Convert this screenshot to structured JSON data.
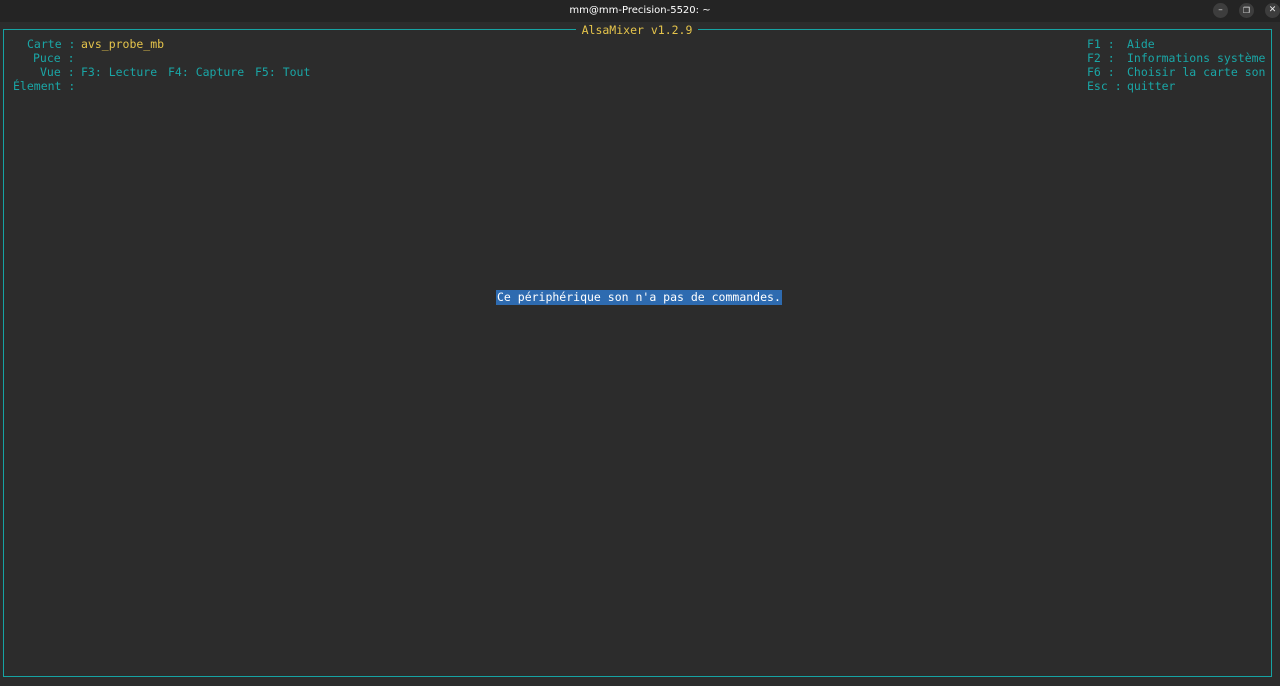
{
  "window": {
    "title": "mm@mm-Precision-5520: ~",
    "controls": {
      "minimize": "–",
      "maximize": "❐",
      "close": "✕"
    }
  },
  "mixer": {
    "title": "AlsaMixer v1.2.9",
    "card_label": "Carte :",
    "card_value": "avs_probe_mb",
    "chip_label": "Puce :",
    "chip_value": "",
    "view_label": "Vue :",
    "views": {
      "playback": "F3: Lecture",
      "capture": "F4: Capture",
      "all": "F5: Tout"
    },
    "element_label": "Élement :",
    "element_value": "",
    "help": [
      {
        "key": "F1 :",
        "action": "Aide"
      },
      {
        "key": "F2 :",
        "action": "Informations système"
      },
      {
        "key": "F6 :",
        "action": "Choisir la carte son"
      },
      {
        "key": "Esc :",
        "action": "quitter"
      }
    ],
    "message": "Ce périphérique son n'a pas de commandes."
  },
  "colors": {
    "cyan": "#1aa6a6",
    "yellow": "#e5c44b",
    "highlight": "#2e6bb0",
    "background": "#2c2c2c"
  }
}
